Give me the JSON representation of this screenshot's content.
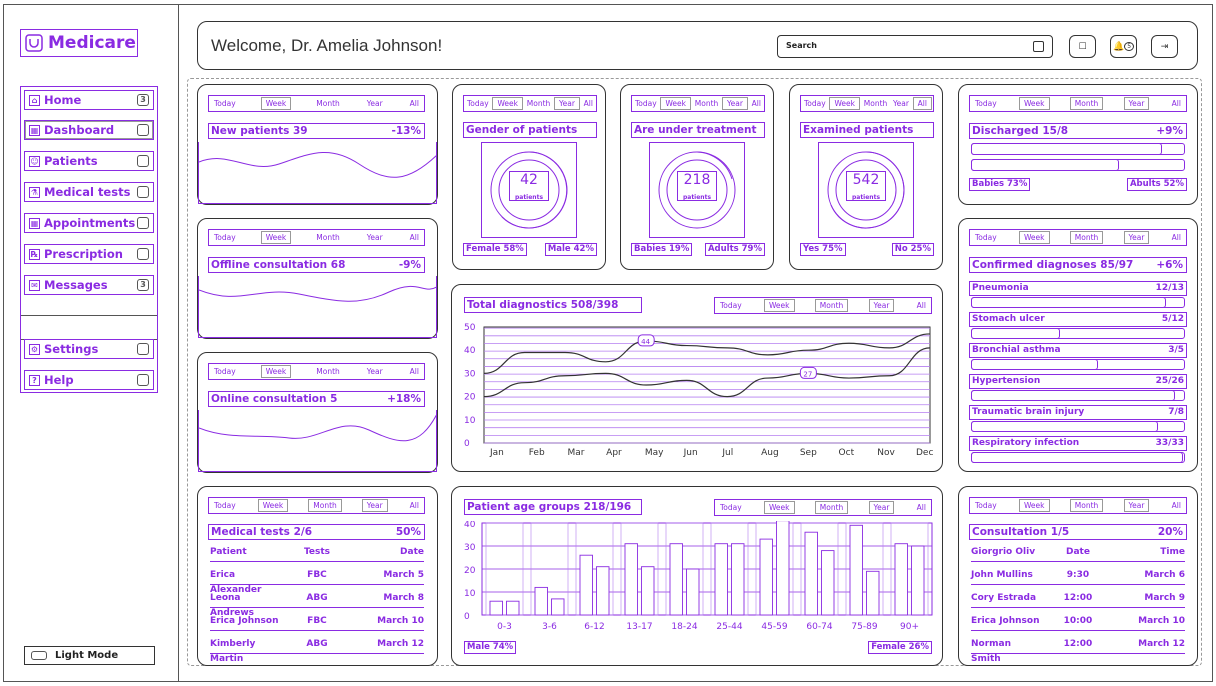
{
  "sidebar": {
    "logo": "Medicare",
    "items": [
      {
        "label": "Home",
        "badge": "3"
      },
      {
        "label": "Dashboard",
        "badge": ""
      },
      {
        "label": "Patients",
        "badge": ""
      },
      {
        "label": "Medical tests",
        "badge": ""
      },
      {
        "label": "Appointments",
        "badge": ""
      },
      {
        "label": "Prescription",
        "badge": ""
      },
      {
        "label": "Messages",
        "badge": "3"
      }
    ],
    "settings": "Settings",
    "help": "Help",
    "light_mode": "Light Mode"
  },
  "header": {
    "welcome": "Welcome, Dr. Amelia Johnson!",
    "search_placeholder": "Search",
    "notif_badge": "5"
  },
  "tabs": {
    "today": "Today",
    "week": "Week",
    "month": "Month",
    "year": "Year",
    "all": "All"
  },
  "new_patients": {
    "title": "New patients 39",
    "pct": "-13%"
  },
  "offline": {
    "title": "Offline consultation 68",
    "pct": "-9%"
  },
  "online": {
    "title": "Online consultation 5",
    "pct": "+18%"
  },
  "gender": {
    "title": "Gender of patients",
    "value": "42",
    "unit": "patients",
    "leg1": "Female 58%",
    "leg2": "Male 42%"
  },
  "treatment": {
    "title": "Are under treatment",
    "value": "218",
    "unit": "patients",
    "leg1": "Babies 19%",
    "leg2": "Adults 79%"
  },
  "examined": {
    "title": "Examined patients",
    "value": "542",
    "unit": "patients",
    "leg1": "Yes 75%",
    "leg2": "No 25%"
  },
  "discharged": {
    "title": "Discharged 15/8",
    "pct": "+9%",
    "bars": [
      0.9,
      0.7
    ],
    "leg1": "Babies 73%",
    "leg2": "Abults 52%"
  },
  "confirmed": {
    "title": "Confirmed diagnoses 85/97",
    "pct": "+6%",
    "items": [
      {
        "name": "Pneumonia",
        "value": "12/13",
        "level": 0.92
      },
      {
        "name": "Stomach ulcer",
        "value": "5/12",
        "level": 0.42
      },
      {
        "name": "Bronchial asthma",
        "value": "3/5",
        "level": 0.6
      },
      {
        "name": "Hypertension",
        "value": "25/26",
        "level": 0.96
      },
      {
        "name": "Traumatic brain injury",
        "value": "7/8",
        "level": 0.88
      },
      {
        "name": "Respiratory infection",
        "value": "33/33",
        "level": 1.0
      }
    ]
  },
  "diagnostics": {
    "title": "Total diagnostics 508/398",
    "yticks": [
      "50",
      "40",
      "30",
      "20",
      "10",
      "0"
    ],
    "callouts": [
      "44",
      "27"
    ]
  },
  "medical_tests": {
    "title": "Medical tests 2/6",
    "pct": "50%",
    "headers": [
      "Patient",
      "Tests",
      "Date"
    ],
    "rows": [
      [
        "Erica Alexander",
        "FBC",
        "March 5"
      ],
      [
        "Leona Andrews",
        "ABG",
        "March 8"
      ],
      [
        "Erica Johnson",
        "FBC",
        "March 10"
      ],
      [
        "Kimberly Martin",
        "ABG",
        "March 12"
      ]
    ]
  },
  "age_groups": {
    "title": "Patient age groups 218/196",
    "yticks": [
      "40",
      "30",
      "20",
      "10",
      "0"
    ],
    "male": "Male 74%",
    "female": "Female 26%"
  },
  "consultation": {
    "title": "Consultation 1/5",
    "pct": "20%",
    "headers": [
      "Giorgrio Oliv",
      "Date",
      "Time"
    ],
    "rows": [
      [
        "John Mullins",
        "9:30",
        "March 6"
      ],
      [
        "Cory Estrada",
        "12:00",
        "March 9"
      ],
      [
        "Erica Johnson",
        "10:00",
        "March 10"
      ],
      [
        "Norman Smith",
        "12:00",
        "March 12"
      ]
    ]
  },
  "chart_data": [
    {
      "type": "line",
      "title": "Total diagnostics 508/398",
      "categories": [
        "Jan",
        "Feb",
        "Mar",
        "Apr",
        "May",
        "Jun",
        "Jul",
        "Aug",
        "Sep",
        "Oct",
        "Nov",
        "Dec"
      ],
      "ylim": [
        0,
        50
      ],
      "series": [
        {
          "values": [
            30,
            39,
            39,
            35,
            44,
            42,
            41,
            38,
            40,
            43,
            41,
            47
          ]
        },
        {
          "values": [
            20,
            26,
            29,
            30,
            25,
            27,
            20,
            28,
            30,
            28,
            29,
            41
          ]
        }
      ]
    },
    {
      "type": "bar",
      "title": "Patient age groups 218/196",
      "categories": [
        "0-3",
        "3-6",
        "6-12",
        "13-17",
        "18-24",
        "25-44",
        "45-59",
        "60-74",
        "75-89",
        "90+"
      ],
      "ylim": [
        0,
        40
      ],
      "series": [
        {
          "name": "Male 74%",
          "values": [
            6,
            12,
            26,
            31,
            31,
            31,
            33,
            36,
            39,
            31
          ]
        },
        {
          "name": "Female 26%",
          "values": [
            6,
            7,
            21,
            21,
            20,
            31,
            41,
            28,
            19,
            30
          ]
        }
      ]
    }
  ]
}
